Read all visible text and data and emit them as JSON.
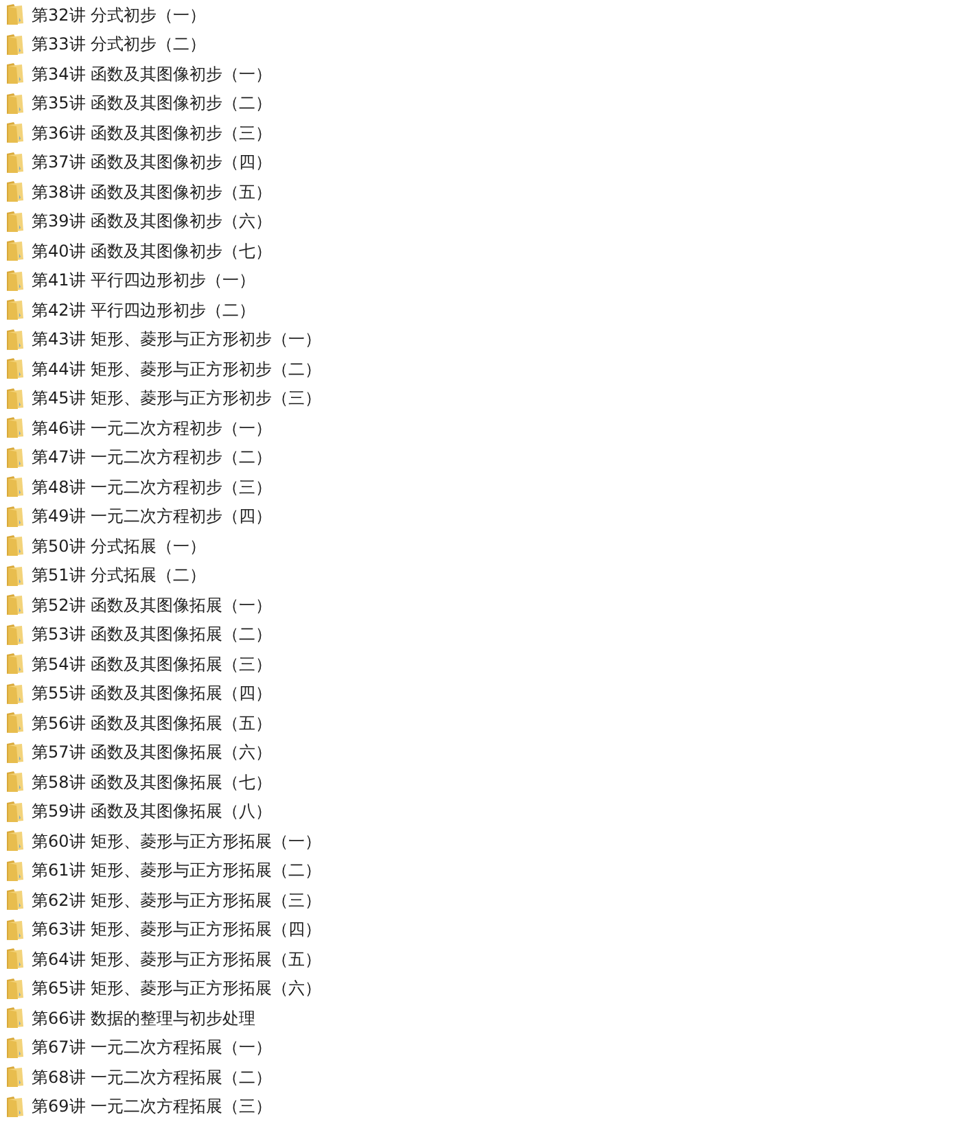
{
  "items": [
    {
      "name": "第32讲 分式初步（一）"
    },
    {
      "name": "第33讲 分式初步（二）"
    },
    {
      "name": "第34讲 函数及其图像初步（一）"
    },
    {
      "name": "第35讲 函数及其图像初步（二）"
    },
    {
      "name": "第36讲 函数及其图像初步（三）"
    },
    {
      "name": "第37讲 函数及其图像初步（四）"
    },
    {
      "name": "第38讲 函数及其图像初步（五）"
    },
    {
      "name": "第39讲 函数及其图像初步（六）"
    },
    {
      "name": "第40讲 函数及其图像初步（七）"
    },
    {
      "name": "第41讲 平行四边形初步（一）"
    },
    {
      "name": "第42讲 平行四边形初步（二）"
    },
    {
      "name": "第43讲 矩形、菱形与正方形初步（一）"
    },
    {
      "name": "第44讲 矩形、菱形与正方形初步（二）"
    },
    {
      "name": "第45讲 矩形、菱形与正方形初步（三）"
    },
    {
      "name": "第46讲 一元二次方程初步（一）"
    },
    {
      "name": "第47讲 一元二次方程初步（二）"
    },
    {
      "name": "第48讲 一元二次方程初步（三）"
    },
    {
      "name": "第49讲 一元二次方程初步（四）"
    },
    {
      "name": "第50讲 分式拓展（一）"
    },
    {
      "name": "第51讲 分式拓展（二）"
    },
    {
      "name": "第52讲 函数及其图像拓展（一）"
    },
    {
      "name": "第53讲 函数及其图像拓展（二）"
    },
    {
      "name": "第54讲 函数及其图像拓展（三）"
    },
    {
      "name": "第55讲 函数及其图像拓展（四）"
    },
    {
      "name": "第56讲 函数及其图像拓展（五）"
    },
    {
      "name": "第57讲 函数及其图像拓展（六）"
    },
    {
      "name": "第58讲 函数及其图像拓展（七）"
    },
    {
      "name": "第59讲 函数及其图像拓展（八）"
    },
    {
      "name": "第60讲 矩形、菱形与正方形拓展（一）"
    },
    {
      "name": "第61讲 矩形、菱形与正方形拓展（二）"
    },
    {
      "name": "第62讲 矩形、菱形与正方形拓展（三）"
    },
    {
      "name": "第63讲 矩形、菱形与正方形拓展（四）"
    },
    {
      "name": "第64讲 矩形、菱形与正方形拓展（五）"
    },
    {
      "name": "第65讲 矩形、菱形与正方形拓展（六）"
    },
    {
      "name": "第66讲 数据的整理与初步处理"
    },
    {
      "name": "第67讲 一元二次方程拓展（一）"
    },
    {
      "name": "第68讲 一元二次方程拓展（二）"
    },
    {
      "name": "第69讲 一元二次方程拓展（三）"
    }
  ]
}
